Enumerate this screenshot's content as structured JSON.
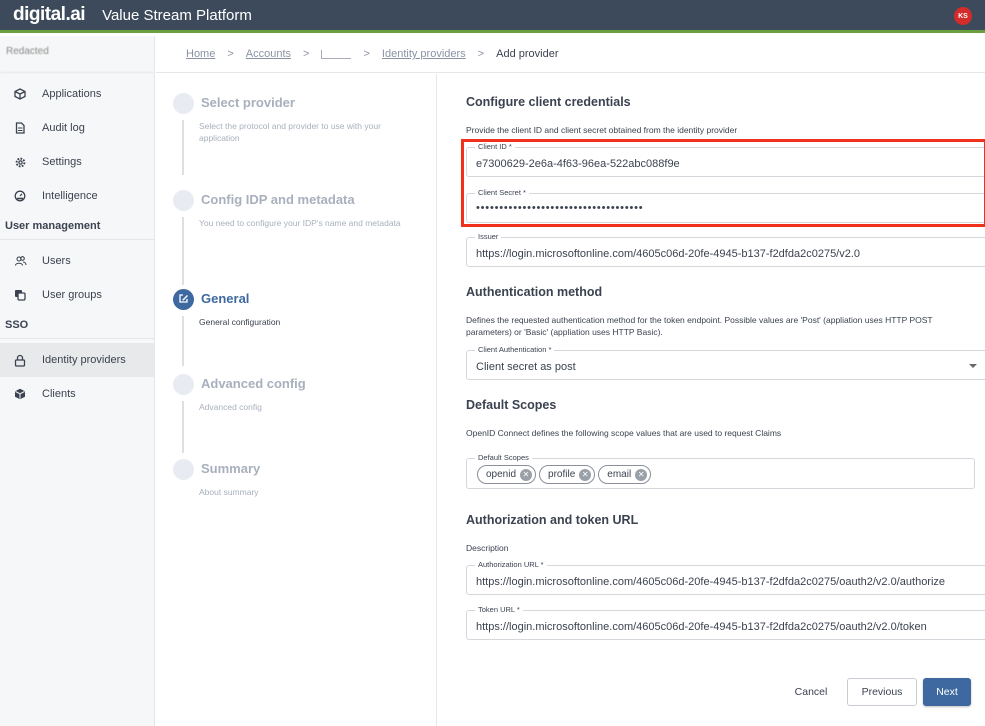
{
  "header": {
    "logo": "digital.ai",
    "app_title": "Value Stream Platform",
    "avatar_initials": "KS",
    "avatar_color": "#d42b2b",
    "accent_bar_color": "#6a9f3f"
  },
  "sidebar": {
    "account_name": "Redacted",
    "items": [
      {
        "label": "Applications",
        "icon": "cube-icon"
      },
      {
        "label": "Audit log",
        "icon": "document-icon"
      },
      {
        "label": "Settings",
        "icon": "gear-icon"
      },
      {
        "label": "Intelligence",
        "icon": "gauge-icon"
      }
    ],
    "sections": [
      {
        "title": "User management",
        "items": [
          {
            "label": "Users",
            "icon": "users-icon"
          },
          {
            "label": "User groups",
            "icon": "groups-icon"
          }
        ]
      },
      {
        "title": "SSO",
        "items": [
          {
            "label": "Identity providers",
            "icon": "lock-icon",
            "active": true
          },
          {
            "label": "Clients",
            "icon": "box-icon"
          }
        ]
      }
    ]
  },
  "breadcrumb": {
    "items": [
      "Home",
      "Accounts",
      "",
      "Identity providers"
    ],
    "current": "Add provider",
    "separator": ">"
  },
  "stepper": {
    "steps": [
      {
        "title": "Select provider",
        "desc": "Select the protocol and provider to use with your application",
        "state": "inactive"
      },
      {
        "title": "Config IDP and metadata",
        "desc": "You need to configure your IDP's name and metadata",
        "state": "inactive"
      },
      {
        "title": "General",
        "desc": "General configuration",
        "state": "active"
      },
      {
        "title": "Advanced config",
        "desc": "Advanced config",
        "state": "inactive"
      },
      {
        "title": "Summary",
        "desc": "About summary",
        "state": "inactive"
      }
    ]
  },
  "form": {
    "credentials": {
      "title": "Configure client credentials",
      "desc": "Provide the client ID and client secret obtained from the identity provider",
      "client_id_label": "Client ID *",
      "client_id_value": "e7300629-2e6a-4f63-96ea-522abc088f9e",
      "client_secret_label": "Client Secret *",
      "client_secret_value": "••••••••••••••••••••••••••••••••••••",
      "issuer_label": "Issuer",
      "issuer_value": "https://login.microsoftonline.com/4605c06d-20fe-4945-b137-f2dfda2c0275/v2.0"
    },
    "auth_method": {
      "title": "Authentication method",
      "desc": "Defines the requested authentication method for the token endpoint. Possible values are 'Post' (appliation uses HTTP POST parameters) or 'Basic' (appliation uses HTTP Basic).",
      "label": "Client Authentication *",
      "value": "Client secret as post"
    },
    "scopes": {
      "title": "Default Scopes",
      "desc": "OpenID Connect defines the following scope values that are used to request Claims",
      "label": "Default Scopes",
      "chips": [
        "openid",
        "profile",
        "email"
      ]
    },
    "urls": {
      "title": "Authorization and token URL",
      "desc": "Description",
      "auth_url_label": "Authorization URL *",
      "auth_url_value": "https://login.microsoftonline.com/4605c06d-20fe-4945-b137-f2dfda2c0275/oauth2/v2.0/authorize",
      "token_url_label": "Token URL *",
      "token_url_value": "https://login.microsoftonline.com/4605c06d-20fe-4945-b137-f2dfda2c0275/oauth2/v2.0/token"
    }
  },
  "actions": {
    "cancel": "Cancel",
    "previous": "Previous",
    "next": "Next",
    "primary_color": "#3e69a0"
  },
  "highlight_color": "#f0311c"
}
